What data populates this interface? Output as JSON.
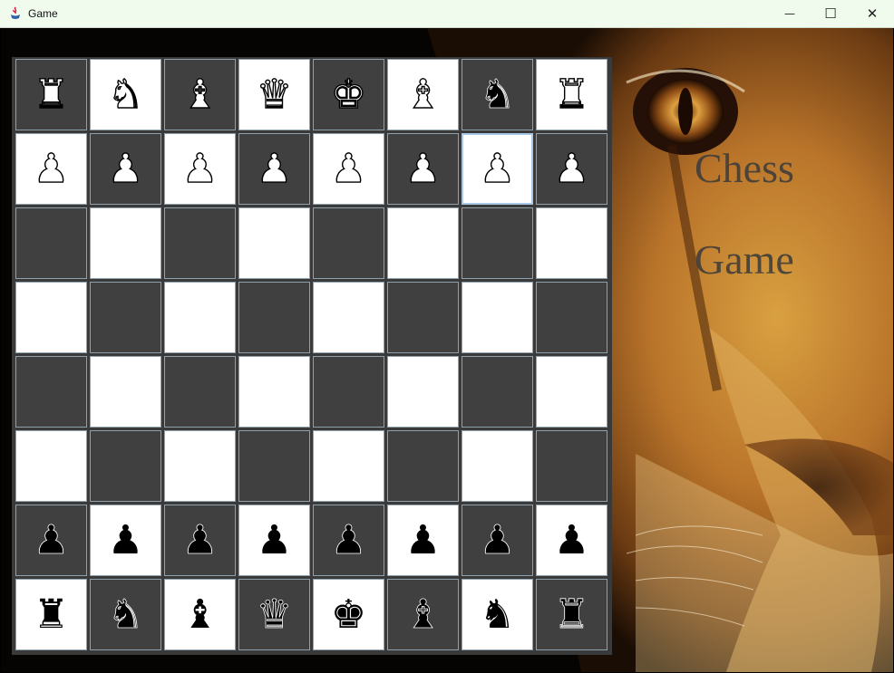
{
  "window": {
    "title": "Game",
    "controls": {
      "minimize": "—",
      "maximize": "☐",
      "close": "✕"
    }
  },
  "heading": {
    "line1": "Chess",
    "line2": "Game"
  },
  "colors": {
    "light_square": "#ffffff",
    "dark_square": "#404040",
    "board_border": "#8fa0ad",
    "selected_border": "#a8c8e8"
  },
  "selected": {
    "row": 1,
    "col": 6
  },
  "board": [
    [
      "♜",
      "♞",
      "♝",
      "♛",
      "♚",
      "♝",
      "♞",
      "♜"
    ],
    [
      "♟",
      "♟",
      "♟",
      "♟",
      "♟",
      "♟",
      "♟",
      "♟"
    ],
    [
      "",
      "",
      "",
      "",
      "",
      "",
      "",
      ""
    ],
    [
      "",
      "",
      "",
      "",
      "",
      "",
      "",
      ""
    ],
    [
      "",
      "",
      "",
      "",
      "",
      "",
      "",
      ""
    ],
    [
      "",
      "",
      "",
      "",
      "",
      "",
      "",
      ""
    ],
    [
      "♟",
      "♟",
      "♟",
      "♟",
      "♟",
      "♟",
      "♟",
      "♟"
    ],
    [
      "♜",
      "♞",
      "♝",
      "♛",
      "♚",
      "♝",
      "♞",
      "♜"
    ]
  ],
  "piece_colors": [
    [
      "white",
      "white",
      "white",
      "white",
      "white",
      "white",
      "black",
      "white"
    ],
    [
      "white",
      "white",
      "white",
      "white",
      "white",
      "white",
      "white",
      "white"
    ],
    [
      "",
      "",
      "",
      "",
      "",
      "",
      "",
      ""
    ],
    [
      "",
      "",
      "",
      "",
      "",
      "",
      "",
      ""
    ],
    [
      "",
      "",
      "",
      "",
      "",
      "",
      "",
      ""
    ],
    [
      "",
      "",
      "",
      "",
      "",
      "",
      "",
      ""
    ],
    [
      "black",
      "black",
      "black",
      "black",
      "black",
      "black",
      "black",
      "black"
    ],
    [
      "black",
      "black",
      "black",
      "black",
      "black",
      "black",
      "black",
      "black"
    ]
  ]
}
